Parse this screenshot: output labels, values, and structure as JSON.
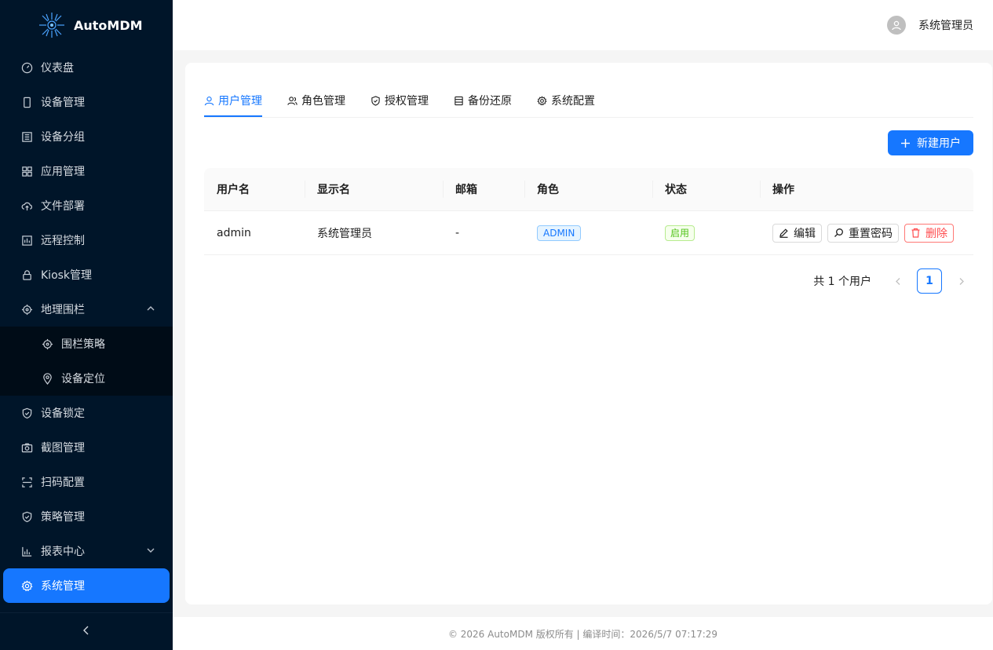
{
  "app": {
    "name": "AutoMDM"
  },
  "header": {
    "username": "系统管理员"
  },
  "sidebar": {
    "items": [
      {
        "label": "仪表盘",
        "icon": "dashboard-icon"
      },
      {
        "label": "设备管理",
        "icon": "mobile-icon"
      },
      {
        "label": "设备分组",
        "icon": "group-icon"
      },
      {
        "label": "应用管理",
        "icon": "appstore-icon"
      },
      {
        "label": "文件部署",
        "icon": "cloud-upload-icon"
      },
      {
        "label": "远程控制",
        "icon": "remote-control-icon"
      },
      {
        "label": "Kiosk管理",
        "icon": "lock-icon"
      },
      {
        "label": "地理围栏",
        "icon": "aim-icon",
        "expanded": true,
        "children": [
          {
            "label": "围栏策略",
            "icon": "aim-icon"
          },
          {
            "label": "设备定位",
            "icon": "location-icon"
          }
        ]
      },
      {
        "label": "设备锁定",
        "icon": "shield-icon"
      },
      {
        "label": "截图管理",
        "icon": "camera-icon"
      },
      {
        "label": "扫码配置",
        "icon": "scan-icon"
      },
      {
        "label": "策略管理",
        "icon": "safety-icon"
      },
      {
        "label": "报表中心",
        "icon": "bar-chart-icon",
        "expanded": false
      },
      {
        "label": "系统管理",
        "icon": "setting-icon",
        "active": true
      }
    ]
  },
  "tabs": [
    {
      "label": "用户管理",
      "icon": "user-icon",
      "active": true
    },
    {
      "label": "角色管理",
      "icon": "team-icon"
    },
    {
      "label": "授权管理",
      "icon": "shield-check-icon"
    },
    {
      "label": "备份还原",
      "icon": "database-icon"
    },
    {
      "label": "系统配置",
      "icon": "setting-icon"
    }
  ],
  "toolbar": {
    "new_user_label": "新建用户"
  },
  "table": {
    "columns": [
      "用户名",
      "显示名",
      "邮箱",
      "角色",
      "状态",
      "操作"
    ],
    "rows": [
      {
        "username": "admin",
        "display_name": "系统管理员",
        "email": "-",
        "role": "ADMIN",
        "status": "启用"
      }
    ],
    "actions": {
      "edit": "编辑",
      "reset_password": "重置密码",
      "delete": "删除"
    }
  },
  "pagination": {
    "total_text": "共 1 个用户",
    "current_page": "1"
  },
  "footer": {
    "text": "© 2026 AutoMDM 版权所有 | 编译时间：2026/5/7 07:17:29"
  },
  "colors": {
    "primary": "#1677ff",
    "sidebar_bg": "#001529",
    "danger": "#ff4d4f",
    "success": "#52c41a"
  }
}
